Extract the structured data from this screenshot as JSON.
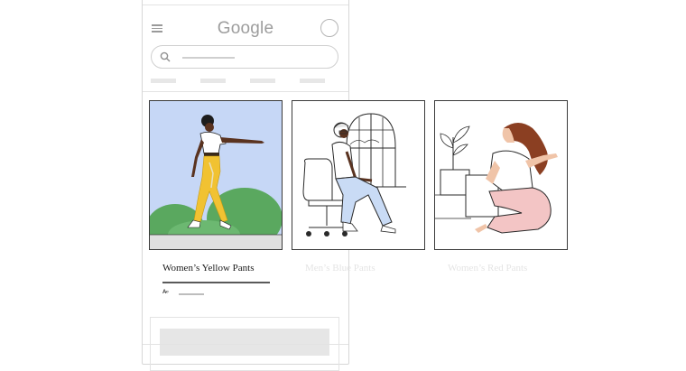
{
  "header": {
    "logo_text": "Google",
    "menu_icon": "hamburger-menu-icon",
    "avatar_icon": "account-circle-icon"
  },
  "search": {
    "icon": "search-icon"
  },
  "results": [
    {
      "title": "Women’s Yellow Pants",
      "selected": true,
      "illustration": "woman-walking-yellow-pants"
    },
    {
      "title": "Men’s Blue Pants",
      "selected": false,
      "illustration": "man-sitting-at-laptop-blue-pants"
    },
    {
      "title": "Women’s Red Pants",
      "selected": false,
      "illustration": "woman-with-plant-pink-pants"
    }
  ],
  "meta": {
    "prefix": "A‹·"
  },
  "colors": {
    "sky": "#c6d7f6",
    "yellow": "#f1c232",
    "green": "#5aa85f",
    "blue_pants": "#c9dbf5",
    "pink_pants": "#f3c5c5",
    "hair": "#8b3f22",
    "skin_dark": "#5a3320",
    "skin_light": "#f0c4a8"
  }
}
